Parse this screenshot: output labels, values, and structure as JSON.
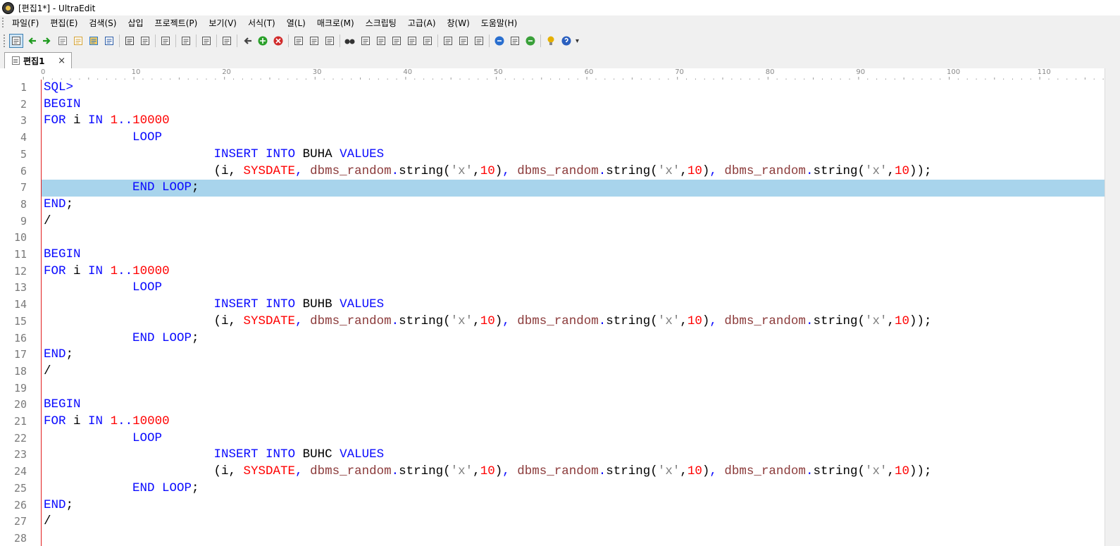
{
  "window": {
    "title": "[편집1*] - UltraEdit"
  },
  "menu": [
    "파일(F)",
    "편집(E)",
    "검색(S)",
    "삽입",
    "프로젝트(P)",
    "보기(V)",
    "서식(T)",
    "열(L)",
    "매크로(M)",
    "스크립팅",
    "고급(A)",
    "창(W)",
    "도움말(H)"
  ],
  "toolbar": {
    "groups": [
      [
        "edit-mode-icon",
        "back-icon",
        "forward-icon",
        "new-file-icon",
        "open-file-icon",
        "open-folder-icon",
        "save-icon"
      ],
      [
        "print-icon",
        "print-preview-icon"
      ],
      [
        "properties-icon"
      ],
      [
        "spell-check-icon"
      ],
      [
        "column-mode-icon"
      ],
      [
        "word-wrap-icon"
      ],
      [
        "nav-back-icon",
        "add-icon",
        "stop-icon"
      ],
      [
        "cut-icon",
        "copy-icon",
        "paste-icon"
      ],
      [
        "find-icon",
        "find-prev-icon",
        "find-next-icon",
        "replace-icon",
        "find-in-files-icon",
        "replace-in-files-icon"
      ],
      [
        "split-horizontal-icon",
        "split-vertical-icon",
        "cascade-icon"
      ],
      [
        "web-icon",
        "screenshot-icon",
        "refresh-icon"
      ],
      [
        "tip-icon",
        "help-icon"
      ]
    ],
    "more": "▾"
  },
  "tab": {
    "label": "편집1",
    "close": "×"
  },
  "ruler": {
    "labels": [
      "0",
      "10",
      "20",
      "30",
      "40",
      "50",
      "60",
      "70",
      "80",
      "90",
      "100",
      "110"
    ]
  },
  "editor": {
    "current_line": 7,
    "colors": {
      "keyword": "#0a0aff",
      "number": "#ff0000",
      "function": "#8b3a3a",
      "string": "#808080",
      "current_line": "#a8d4ec",
      "margin": "#e21e1e"
    },
    "lines": [
      [
        {
          "t": "kw",
          "v": "SQL>"
        }
      ],
      [
        {
          "t": "kw",
          "v": "BEGIN"
        }
      ],
      [
        {
          "t": "kw",
          "v": "FOR"
        },
        {
          "t": "tx",
          "v": " i "
        },
        {
          "t": "kw",
          "v": "IN"
        },
        {
          "t": "tx",
          "v": " "
        },
        {
          "t": "nm",
          "v": "1"
        },
        {
          "t": "kw",
          "v": ".."
        },
        {
          "t": "nm",
          "v": "10000"
        }
      ],
      [
        {
          "t": "tx",
          "v": "            "
        },
        {
          "t": "kw",
          "v": "LOOP"
        }
      ],
      [
        {
          "t": "tx",
          "v": "                       "
        },
        {
          "t": "kw",
          "v": "INSERT INTO"
        },
        {
          "t": "tx",
          "v": " BUHA "
        },
        {
          "t": "kw",
          "v": "VALUES"
        }
      ],
      [
        {
          "t": "tx",
          "v": "                       (i, "
        },
        {
          "t": "nm",
          "v": "SYSDATE"
        },
        {
          "t": "kw",
          "v": ","
        },
        {
          "t": "tx",
          "v": " "
        },
        {
          "t": "fn",
          "v": "dbms_random"
        },
        {
          "t": "kw",
          "v": "."
        },
        {
          "t": "tx",
          "v": "string("
        },
        {
          "t": "st",
          "v": "'x'"
        },
        {
          "t": "tx",
          "v": ","
        },
        {
          "t": "nm",
          "v": "10"
        },
        {
          "t": "tx",
          "v": ")"
        },
        {
          "t": "kw",
          "v": ","
        },
        {
          "t": "tx",
          "v": " "
        },
        {
          "t": "fn",
          "v": "dbms_random"
        },
        {
          "t": "kw",
          "v": "."
        },
        {
          "t": "tx",
          "v": "string("
        },
        {
          "t": "st",
          "v": "'x'"
        },
        {
          "t": "tx",
          "v": ","
        },
        {
          "t": "nm",
          "v": "10"
        },
        {
          "t": "tx",
          "v": ")"
        },
        {
          "t": "kw",
          "v": ","
        },
        {
          "t": "tx",
          "v": " "
        },
        {
          "t": "fn",
          "v": "dbms_random"
        },
        {
          "t": "kw",
          "v": "."
        },
        {
          "t": "tx",
          "v": "string("
        },
        {
          "t": "st",
          "v": "'x'"
        },
        {
          "t": "tx",
          "v": ","
        },
        {
          "t": "nm",
          "v": "10"
        },
        {
          "t": "tx",
          "v": "));"
        }
      ],
      [
        {
          "t": "tx",
          "v": "            "
        },
        {
          "t": "kw",
          "v": "END LOOP"
        },
        {
          "t": "tx",
          "v": ";"
        }
      ],
      [
        {
          "t": "kw",
          "v": "END"
        },
        {
          "t": "tx",
          "v": ";"
        }
      ],
      [
        {
          "t": "tx",
          "v": "/"
        }
      ],
      [],
      [
        {
          "t": "kw",
          "v": "BEGIN"
        }
      ],
      [
        {
          "t": "kw",
          "v": "FOR"
        },
        {
          "t": "tx",
          "v": " i "
        },
        {
          "t": "kw",
          "v": "IN"
        },
        {
          "t": "tx",
          "v": " "
        },
        {
          "t": "nm",
          "v": "1"
        },
        {
          "t": "kw",
          "v": ".."
        },
        {
          "t": "nm",
          "v": "10000"
        }
      ],
      [
        {
          "t": "tx",
          "v": "            "
        },
        {
          "t": "kw",
          "v": "LOOP"
        }
      ],
      [
        {
          "t": "tx",
          "v": "                       "
        },
        {
          "t": "kw",
          "v": "INSERT INTO"
        },
        {
          "t": "tx",
          "v": " BUHB "
        },
        {
          "t": "kw",
          "v": "VALUES"
        }
      ],
      [
        {
          "t": "tx",
          "v": "                       (i, "
        },
        {
          "t": "nm",
          "v": "SYSDATE"
        },
        {
          "t": "kw",
          "v": ","
        },
        {
          "t": "tx",
          "v": " "
        },
        {
          "t": "fn",
          "v": "dbms_random"
        },
        {
          "t": "kw",
          "v": "."
        },
        {
          "t": "tx",
          "v": "string("
        },
        {
          "t": "st",
          "v": "'x'"
        },
        {
          "t": "tx",
          "v": ","
        },
        {
          "t": "nm",
          "v": "10"
        },
        {
          "t": "tx",
          "v": ")"
        },
        {
          "t": "kw",
          "v": ","
        },
        {
          "t": "tx",
          "v": " "
        },
        {
          "t": "fn",
          "v": "dbms_random"
        },
        {
          "t": "kw",
          "v": "."
        },
        {
          "t": "tx",
          "v": "string("
        },
        {
          "t": "st",
          "v": "'x'"
        },
        {
          "t": "tx",
          "v": ","
        },
        {
          "t": "nm",
          "v": "10"
        },
        {
          "t": "tx",
          "v": ")"
        },
        {
          "t": "kw",
          "v": ","
        },
        {
          "t": "tx",
          "v": " "
        },
        {
          "t": "fn",
          "v": "dbms_random"
        },
        {
          "t": "kw",
          "v": "."
        },
        {
          "t": "tx",
          "v": "string("
        },
        {
          "t": "st",
          "v": "'x'"
        },
        {
          "t": "tx",
          "v": ","
        },
        {
          "t": "nm",
          "v": "10"
        },
        {
          "t": "tx",
          "v": "));"
        }
      ],
      [
        {
          "t": "tx",
          "v": "            "
        },
        {
          "t": "kw",
          "v": "END LOOP"
        },
        {
          "t": "tx",
          "v": ";"
        }
      ],
      [
        {
          "t": "kw",
          "v": "END"
        },
        {
          "t": "tx",
          "v": ";"
        }
      ],
      [
        {
          "t": "tx",
          "v": "/"
        }
      ],
      [],
      [
        {
          "t": "kw",
          "v": "BEGIN"
        }
      ],
      [
        {
          "t": "kw",
          "v": "FOR"
        },
        {
          "t": "tx",
          "v": " i "
        },
        {
          "t": "kw",
          "v": "IN"
        },
        {
          "t": "tx",
          "v": " "
        },
        {
          "t": "nm",
          "v": "1"
        },
        {
          "t": "kw",
          "v": ".."
        },
        {
          "t": "nm",
          "v": "10000"
        }
      ],
      [
        {
          "t": "tx",
          "v": "            "
        },
        {
          "t": "kw",
          "v": "LOOP"
        }
      ],
      [
        {
          "t": "tx",
          "v": "                       "
        },
        {
          "t": "kw",
          "v": "INSERT INTO"
        },
        {
          "t": "tx",
          "v": " BUHC "
        },
        {
          "t": "kw",
          "v": "VALUES"
        }
      ],
      [
        {
          "t": "tx",
          "v": "                       (i, "
        },
        {
          "t": "nm",
          "v": "SYSDATE"
        },
        {
          "t": "kw",
          "v": ","
        },
        {
          "t": "tx",
          "v": " "
        },
        {
          "t": "fn",
          "v": "dbms_random"
        },
        {
          "t": "kw",
          "v": "."
        },
        {
          "t": "tx",
          "v": "string("
        },
        {
          "t": "st",
          "v": "'x'"
        },
        {
          "t": "tx",
          "v": ","
        },
        {
          "t": "nm",
          "v": "10"
        },
        {
          "t": "tx",
          "v": ")"
        },
        {
          "t": "kw",
          "v": ","
        },
        {
          "t": "tx",
          "v": " "
        },
        {
          "t": "fn",
          "v": "dbms_random"
        },
        {
          "t": "kw",
          "v": "."
        },
        {
          "t": "tx",
          "v": "string("
        },
        {
          "t": "st",
          "v": "'x'"
        },
        {
          "t": "tx",
          "v": ","
        },
        {
          "t": "nm",
          "v": "10"
        },
        {
          "t": "tx",
          "v": ")"
        },
        {
          "t": "kw",
          "v": ","
        },
        {
          "t": "tx",
          "v": " "
        },
        {
          "t": "fn",
          "v": "dbms_random"
        },
        {
          "t": "kw",
          "v": "."
        },
        {
          "t": "tx",
          "v": "string("
        },
        {
          "t": "st",
          "v": "'x'"
        },
        {
          "t": "tx",
          "v": ","
        },
        {
          "t": "nm",
          "v": "10"
        },
        {
          "t": "tx",
          "v": "));"
        }
      ],
      [
        {
          "t": "tx",
          "v": "            "
        },
        {
          "t": "kw",
          "v": "END LOOP"
        },
        {
          "t": "tx",
          "v": ";"
        }
      ],
      [
        {
          "t": "kw",
          "v": "END"
        },
        {
          "t": "tx",
          "v": ";"
        }
      ],
      [
        {
          "t": "tx",
          "v": "/"
        }
      ],
      []
    ]
  }
}
